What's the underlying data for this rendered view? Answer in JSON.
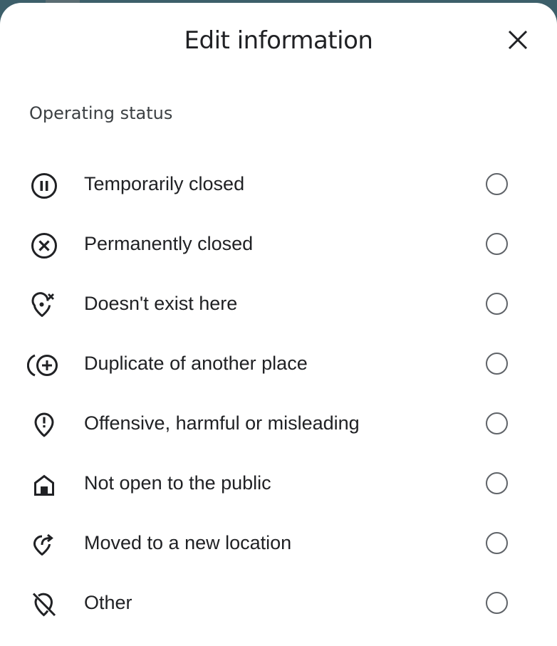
{
  "dialog": {
    "title": "Edit information",
    "close_icon": "close-icon"
  },
  "section": {
    "label": "Operating status"
  },
  "options": [
    {
      "label": "Temporarily closed",
      "icon": "pause-circle-icon",
      "selected": false
    },
    {
      "label": "Permanently closed",
      "icon": "cancel-circle-icon",
      "selected": false
    },
    {
      "label": "Doesn't exist here",
      "icon": "location-off-icon",
      "selected": false
    },
    {
      "label": "Duplicate of another place",
      "icon": "duplicate-add-icon",
      "selected": false
    },
    {
      "label": "Offensive, harmful or misleading",
      "icon": "location-alert-icon",
      "selected": false
    },
    {
      "label": "Not open to the public",
      "icon": "private-home-icon",
      "selected": false
    },
    {
      "label": "Moved to a new location",
      "icon": "location-moved-icon",
      "selected": false
    },
    {
      "label": "Other",
      "icon": "location-disabled-icon",
      "selected": false
    }
  ],
  "colors": {
    "text": "#202124",
    "icon": "#202124",
    "radio_border": "#5f6368",
    "sheet_background": "#ffffff"
  }
}
